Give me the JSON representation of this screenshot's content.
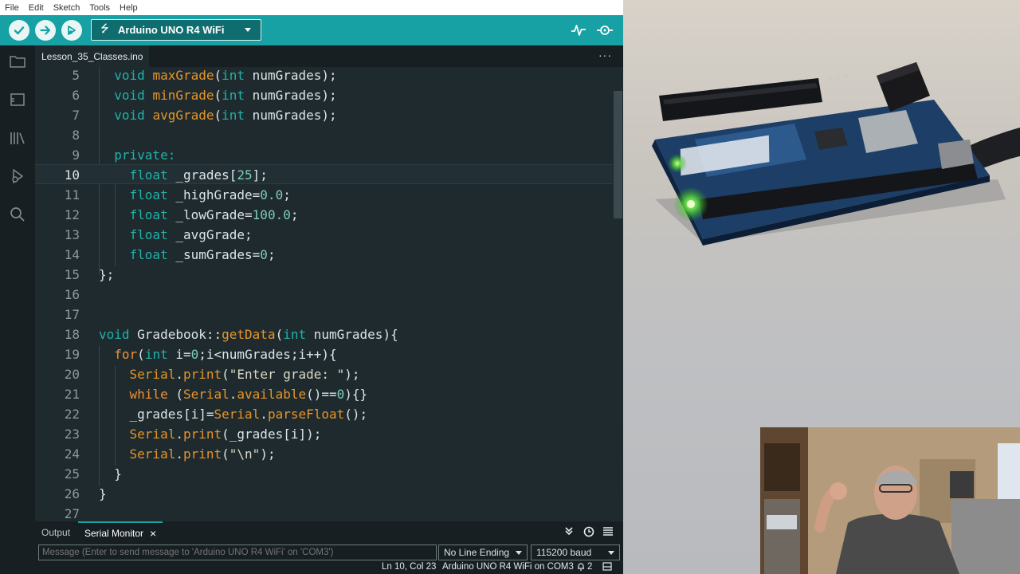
{
  "menu": [
    "File",
    "Edit",
    "Sketch",
    "Tools",
    "Help"
  ],
  "toolbar": {
    "verify_icon": "checkmark-icon",
    "upload_icon": "arrow-right-icon",
    "debug_icon": "debug-icon",
    "board_name": "Arduino UNO R4 WiFi",
    "plotter_icon": "serial-plotter-icon",
    "monitor_icon": "serial-monitor-icon",
    "accent_color": "#17a1a5"
  },
  "sidebar": [
    "folder-icon",
    "boards-manager-icon",
    "library-icon",
    "debug-icon",
    "search-icon"
  ],
  "editor": {
    "tab_label": "Lesson_35_Classes.ino",
    "more_label": "···",
    "current_line": 10
  },
  "bottom": {
    "tab_output": "Output",
    "tab_serial": "Serial Monitor",
    "close": "×",
    "input_placeholder": "Message (Enter to send message to 'Arduino UNO R4 WiFi' on 'COM3')",
    "line_ending": "No Line Ending",
    "baud": "115200 baud"
  },
  "status": {
    "position": "Ln 10, Col 23",
    "board_port": "Arduino UNO R4 WiFi on COM3",
    "notifications": "2"
  }
}
